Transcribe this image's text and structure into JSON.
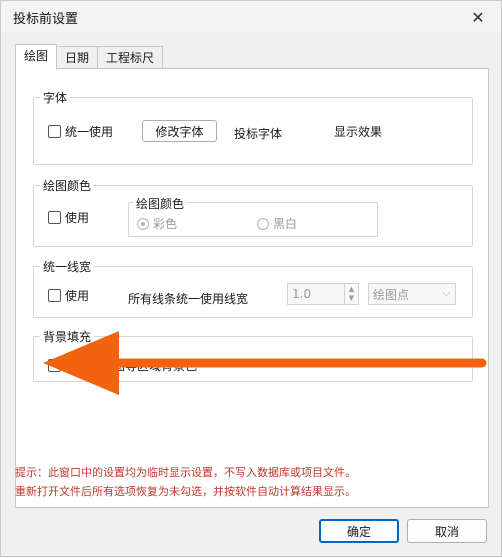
{
  "window": {
    "title": "投标前设置",
    "close_glyph": "✕"
  },
  "tabs": [
    {
      "label": "绘图",
      "active": true
    },
    {
      "label": "日期",
      "active": false
    },
    {
      "label": "工程标尺",
      "active": false
    }
  ],
  "font_group": {
    "title": "字体",
    "unify_label": "统一使用",
    "modify_button": "修改字体",
    "font_label": "投标字体",
    "preview_text": "显示效果"
  },
  "color_group": {
    "title": "绘图颜色",
    "use_label": "使用",
    "inner_title": "绘图颜色",
    "option_color": "彩色",
    "option_mono": "黑白"
  },
  "linewidth_group": {
    "title": "统一线宽",
    "use_label": "使用",
    "desc": "所有线条统一使用线宽",
    "value": "1.0",
    "unit": "绘图点"
  },
  "background_group": {
    "title": "背景填充",
    "desc": "日历、绘图等区域背景色"
  },
  "hints": {
    "line1": "提示：此窗口中的设置均为临时显示设置，不写入数据库或项目文件。",
    "line2": "重新打开文件后所有选项恢复为未勾选，并按软件自动计算结果显示。"
  },
  "buttons": {
    "ok": "确定",
    "cancel": "取消"
  },
  "colors": {
    "hint_text": "#c0392b",
    "ok_border": "#0067c0",
    "annotation_arrow": "#f2620f"
  },
  "icons": {
    "close": "close-icon",
    "spin_up": "chevron-up-icon",
    "spin_down": "chevron-down-icon",
    "dropdown": "chevron-down-icon",
    "annotation": "arrow-left-icon"
  }
}
